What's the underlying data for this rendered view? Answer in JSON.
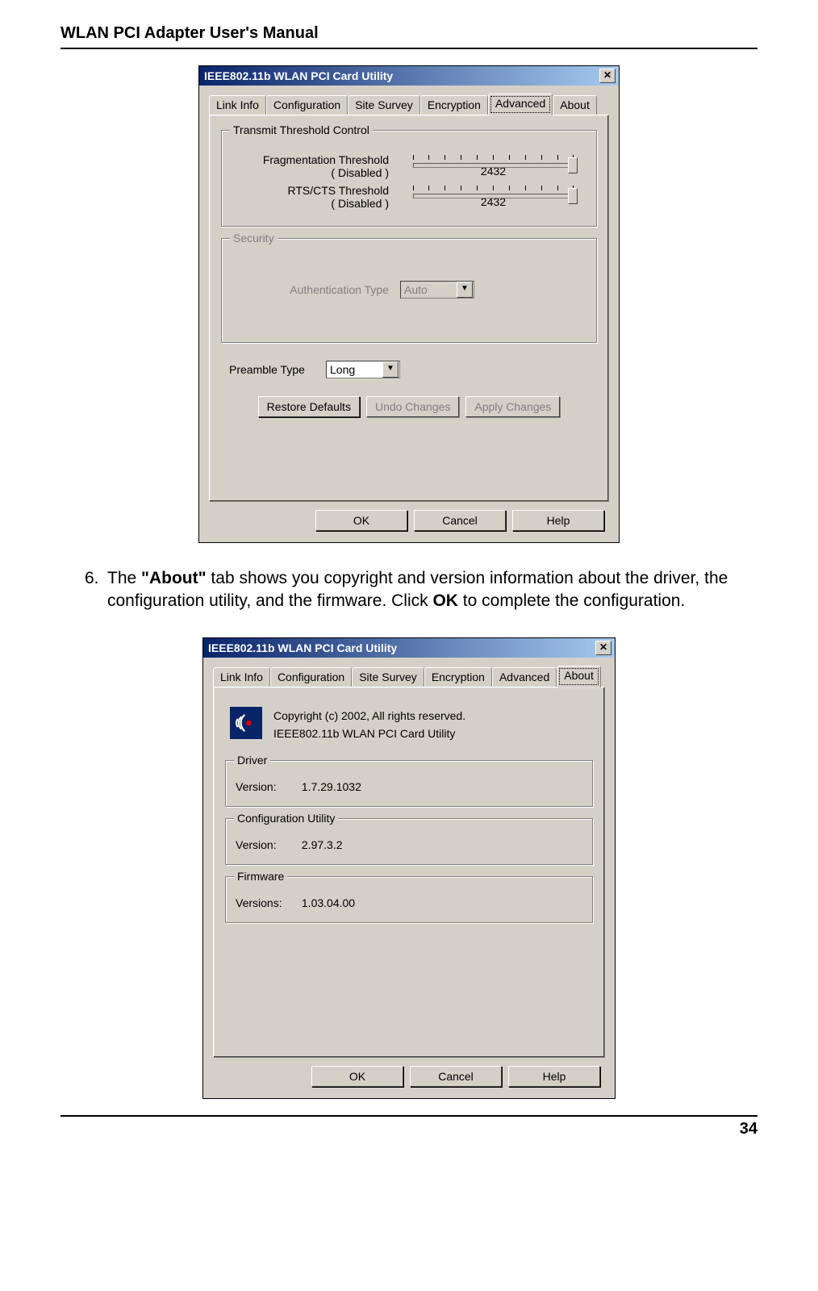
{
  "page": {
    "header": "WLAN PCI Adapter User's Manual",
    "pageNumber": "34"
  },
  "bodyText": {
    "num": "6.",
    "part1": "The ",
    "bold1": "\"About\"",
    "part2": " tab shows you copyright and version information about the driver, the configuration utility, and the firmware. Click ",
    "bold2": "OK",
    "part3": " to complete the configuration."
  },
  "dialog1": {
    "title": "IEEE802.11b WLAN PCI Card Utility",
    "tabs": [
      "Link Info",
      "Configuration",
      "Site Survey",
      "Encryption",
      "Advanced",
      "About"
    ],
    "activeTab": 4,
    "transmitGroup": "Transmit Threshold Control",
    "fragLabel": "Fragmentation Threshold",
    "fragSub": "( Disabled )",
    "fragValue": "2432",
    "rtsLabel": "RTS/CTS Threshold",
    "rtsSub": "( Disabled )",
    "rtsValue": "2432",
    "securityGroup": "Security",
    "authLabel": "Authentication Type",
    "authValue": "Auto",
    "preambleLabel": "Preamble Type",
    "preambleValue": "Long",
    "restore": "Restore Defaults",
    "undo": "Undo Changes",
    "apply": "Apply Changes",
    "ok": "OK",
    "cancel": "Cancel",
    "help": "Help"
  },
  "dialog2": {
    "title": "IEEE802.11b WLAN PCI Card Utility",
    "tabs": [
      "Link Info",
      "Configuration",
      "Site Survey",
      "Encryption",
      "Advanced",
      "About"
    ],
    "activeTab": 5,
    "copyright": "Copyright (c) 2002, All rights reserved.",
    "appname": "IEEE802.11b WLAN PCI Card Utility",
    "driverGroup": "Driver",
    "driverVerLabel": "Version:",
    "driverVer": "1.7.29.1032",
    "configGroup": "Configuration Utility",
    "configVerLabel": "Version:",
    "configVer": "2.97.3.2",
    "firmwareGroup": "Firmware",
    "firmwareVerLabel": "Versions:",
    "firmwareVer": "1.03.04.00",
    "ok": "OK",
    "cancel": "Cancel",
    "help": "Help"
  }
}
